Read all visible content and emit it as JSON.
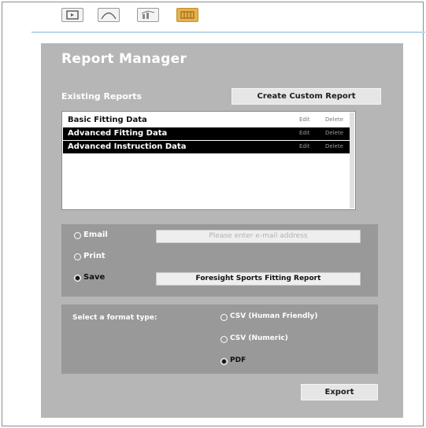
{
  "toolbar": {
    "icons": [
      "video-icon",
      "curve-icon",
      "chart-icon",
      "report-icon"
    ],
    "active_icon": "report-icon"
  },
  "report_manager": {
    "title": "Report Manager",
    "existing_label": "Existing Reports",
    "create_button": "Create Custom Report",
    "reports": [
      {
        "name": "Basic Fitting Data",
        "edit": "Edit",
        "delete": "Delete",
        "selected": false
      },
      {
        "name": "Advanced Fitting Data",
        "edit": "Edit",
        "delete": "Delete",
        "selected": true
      },
      {
        "name": "Advanced Instruction Data",
        "edit": "Edit",
        "delete": "Delete",
        "selected": true
      }
    ]
  },
  "output": {
    "email_label": "Email",
    "email_placeholder": "Please enter e-mail address",
    "print_label": "Print",
    "save_label": "Save",
    "save_filename": "Foresight Sports Fitting Report",
    "selected": "save"
  },
  "format": {
    "label": "Select a format type:",
    "options": [
      "CSV (Human Friendly)",
      "CSV (Numeric)",
      "PDF"
    ],
    "selected": "PDF"
  },
  "export_button": "Export",
  "colors": {
    "panel": "#b6b6b6",
    "section": "#999999",
    "active_tool": "#e6b14a",
    "divider": "#b9d5ea"
  }
}
